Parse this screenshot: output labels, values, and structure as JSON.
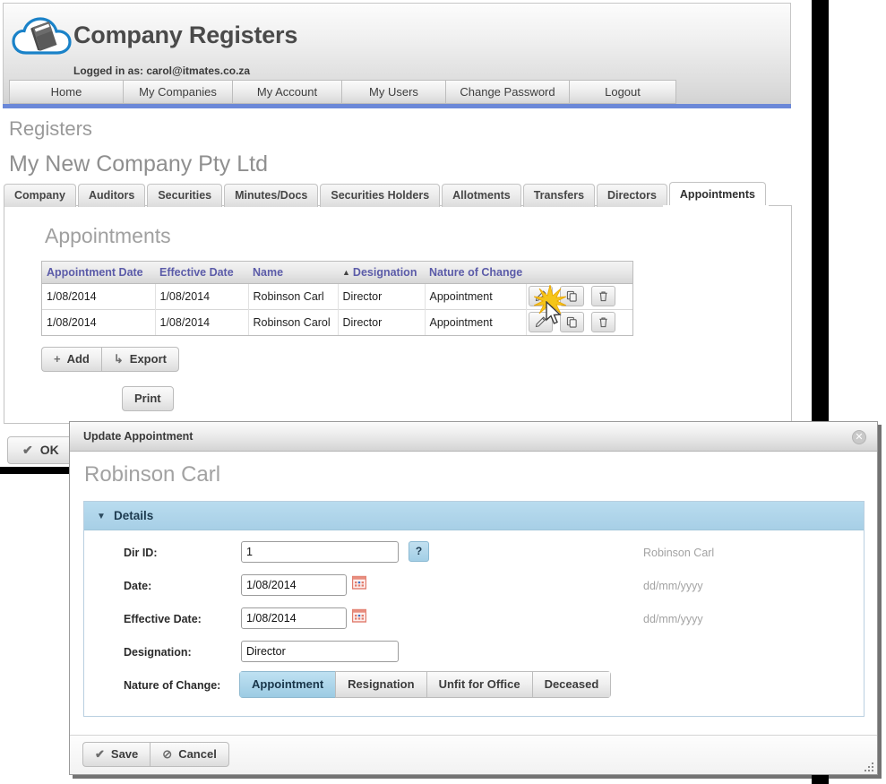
{
  "header": {
    "logo_icon": "cloud-book-icon",
    "title": "Company Registers",
    "logged_in": "Logged in as: carol@itmates.co.za",
    "accent_color": "#6b88d8",
    "nav": [
      {
        "label": "Home"
      },
      {
        "label": "My Companies"
      },
      {
        "label": "My Account"
      },
      {
        "label": "My Users"
      },
      {
        "label": "Change Password"
      },
      {
        "label": "Logout"
      }
    ]
  },
  "breadcrumb": {
    "registers": "Registers",
    "company": "My New Company Pty Ltd"
  },
  "tabs": [
    {
      "label": "Company",
      "active": false
    },
    {
      "label": "Auditors",
      "active": false
    },
    {
      "label": "Securities",
      "active": false
    },
    {
      "label": "Minutes/Docs",
      "active": false
    },
    {
      "label": "Securities Holders",
      "active": false
    },
    {
      "label": "Allotments",
      "active": false
    },
    {
      "label": "Transfers",
      "active": false
    },
    {
      "label": "Directors",
      "active": false
    },
    {
      "label": "Appointments",
      "active": true
    }
  ],
  "main": {
    "section_title": "Appointments",
    "table": {
      "columns": [
        "Appointment Date",
        "Effective Date",
        "Name",
        "Designation",
        "Nature of Change"
      ],
      "sorted_column": "Designation",
      "sort_direction": "asc",
      "sort_glyph": "▲",
      "header_color": "#5b5ba8",
      "rows": [
        {
          "appointment_date": "1/08/2014",
          "effective_date": "1/08/2014",
          "name": "Robinson Carl",
          "designation": "Director",
          "nature_of_change": "Appointment"
        },
        {
          "appointment_date": "1/08/2014",
          "effective_date": "1/08/2014",
          "name": "Robinson Carol",
          "designation": "Director",
          "nature_of_change": "Appointment"
        }
      ],
      "row_actions": [
        {
          "icon": "edit-pencil-icon"
        },
        {
          "icon": "copy-duplicate-icon"
        },
        {
          "icon": "delete-trash-icon"
        }
      ]
    },
    "buttons": {
      "add": {
        "icon": "plus-icon",
        "glyph": "+",
        "label": "Add"
      },
      "export": {
        "icon": "export-arrow-icon",
        "glyph": "↳",
        "label": "Export"
      },
      "print": {
        "label": "Print"
      },
      "ok": {
        "icon": "check-icon",
        "glyph": "✔",
        "label": "OK"
      }
    }
  },
  "modal": {
    "title": "Update Appointment",
    "close_icon": "close-circle-icon",
    "close_glyph": "✕",
    "person": "Robinson Carl",
    "panel": {
      "caret_icon": "chevron-down-icon",
      "caret_glyph": "▼",
      "label": "Details",
      "accent_color": "#a7cfe6"
    },
    "fields": [
      {
        "label": "Dir ID:",
        "value": "1",
        "hint": "Robinson Carl",
        "help": "?",
        "help_icon": "help-question-icon"
      },
      {
        "label": "Date:",
        "value": "1/08/2014",
        "hint": "dd/mm/yyyy",
        "calendar_icon": "calendar-picker-icon"
      },
      {
        "label": "Effective Date:",
        "value": "1/08/2014",
        "hint": "dd/mm/yyyy",
        "calendar_icon": "calendar-picker-icon"
      },
      {
        "label": "Designation:",
        "value": "Director",
        "hint": ""
      }
    ],
    "nature_of_change": {
      "label": "Nature of Change:",
      "options": [
        {
          "label": "Appointment",
          "selected": true
        },
        {
          "label": "Resignation",
          "selected": false
        },
        {
          "label": "Unfit for Office",
          "selected": false
        },
        {
          "label": "Deceased",
          "selected": false
        }
      ]
    },
    "footer": {
      "save": {
        "icon": "check-icon",
        "glyph": "✔",
        "label": "Save"
      },
      "cancel": {
        "icon": "ban-icon",
        "glyph": "⊘",
        "label": "Cancel"
      }
    },
    "resize_grip_icon": "resize-grip-icon"
  }
}
